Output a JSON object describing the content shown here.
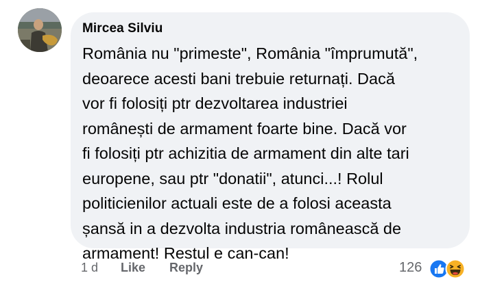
{
  "comment": {
    "author": "Mircea Silviu",
    "lines": [
      "România nu \"primeste\", România \"împrumută\",",
      "deoarece acesti bani trebuie returnați. Dacă",
      "vor fi folosiți ptr dezvoltarea industriei",
      "românești de armament foarte bine. Dacă vor",
      "fi folosiți ptr achizitia de armament din alte tari",
      "europene, sau ptr \"donatii\", atunci...! Rolul",
      "politicienilor actuali este de a folosi aceasta",
      "șansă in a dezvolta industria românească de",
      "armament! Restul e can-can!"
    ],
    "bubble_color": "#f0f2f5"
  },
  "footer": {
    "timestamp": "1 d",
    "like_label": "Like",
    "reply_label": "Reply",
    "reaction_count": "126",
    "reactions": [
      "like-icon",
      "haha-icon"
    ]
  },
  "colors": {
    "text": "#050505",
    "meta": "#65676b",
    "like_blue": "#1877f2",
    "haha_yellow": "#f7b125"
  }
}
